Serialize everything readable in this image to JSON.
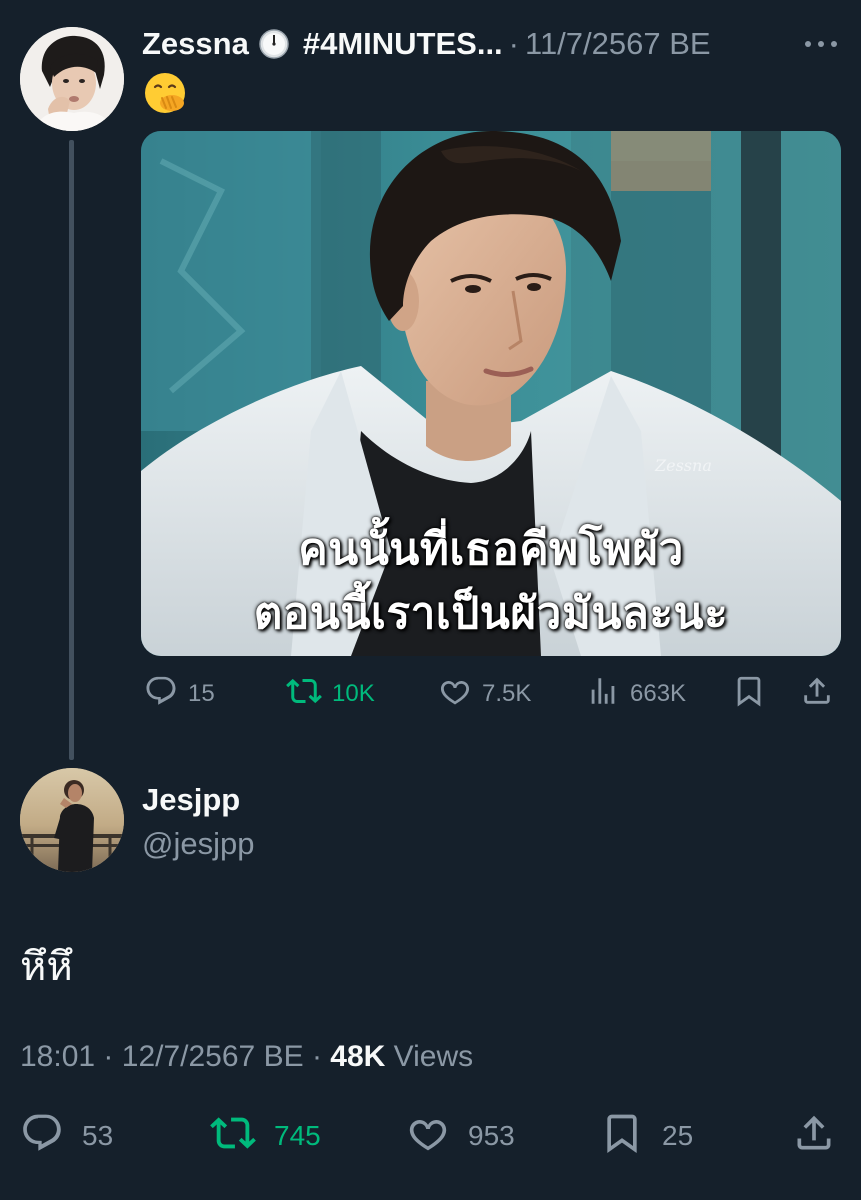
{
  "parent_tweet": {
    "display_name": "Zessna",
    "name_emoji": "clock-emoji",
    "hashtag_suffix": "#4MINUTES...",
    "separator": "·",
    "date": "11/7/2567 BE",
    "text_emoji": "hand-over-mouth-emoji",
    "media": {
      "subtitle_line_1": "คนนั้นที่เธอคีพโพผัว",
      "subtitle_line_2": "ตอนนี้เราเป็นผัวมันละนะ",
      "watermark": "Zessna"
    },
    "actions": {
      "replies": "15",
      "retweets": "10K",
      "likes": "7.5K",
      "views": "663K"
    }
  },
  "reply_tweet": {
    "display_name": "Jesjpp",
    "handle": "@jesjpp",
    "text": "หึหึ",
    "time": "18:01",
    "separator": "·",
    "date": "12/7/2567 BE",
    "views_count": "48K",
    "views_label": "Views",
    "actions": {
      "replies": "53",
      "retweets": "745",
      "likes": "953",
      "bookmarks": "25"
    }
  },
  "colors": {
    "background": "#15202b",
    "primary_text": "#f7f9f9",
    "secondary_text": "#8b98a5",
    "retweet_active": "#00ba7c",
    "thread_line": "#42505e"
  }
}
